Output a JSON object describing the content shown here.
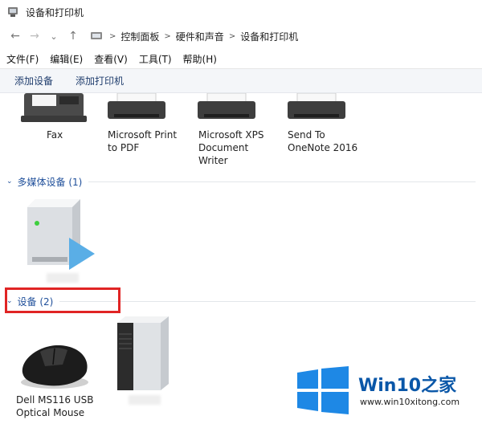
{
  "window": {
    "title": "设备和打印机"
  },
  "address": {
    "back": "←",
    "forward": "→",
    "down": "⌄",
    "up": "↑",
    "breadcrumbs": [
      "控制面板",
      "硬件和声音",
      "设备和打印机"
    ],
    "separator": ">"
  },
  "menu": [
    "文件(F)",
    "编辑(E)",
    "查看(V)",
    "工具(T)",
    "帮助(H)"
  ],
  "commands": {
    "add_device": "添加设备",
    "add_printer": "添加打印机"
  },
  "printers": [
    {
      "label": "Fax"
    },
    {
      "label": "Microsoft Print to PDF"
    },
    {
      "label": "Microsoft XPS Document Writer"
    },
    {
      "label": "Send To OneNote 2016"
    }
  ],
  "multimedia_group": {
    "title": "多媒体设备 (1)"
  },
  "devices_group": {
    "title": "设备 (2)"
  },
  "devices": [
    {
      "label": "Dell MS116 USB Optical Mouse"
    },
    {
      "label": ""
    }
  ],
  "watermark": {
    "brand": "Win10",
    "brand_suffix": "之家",
    "url": "www.win10xitong.com"
  },
  "colors": {
    "group_header": "#1f4f9a",
    "highlight": "#e02424",
    "watermark_blue": "#0a57a8",
    "win_logo": "#1e88e5"
  }
}
